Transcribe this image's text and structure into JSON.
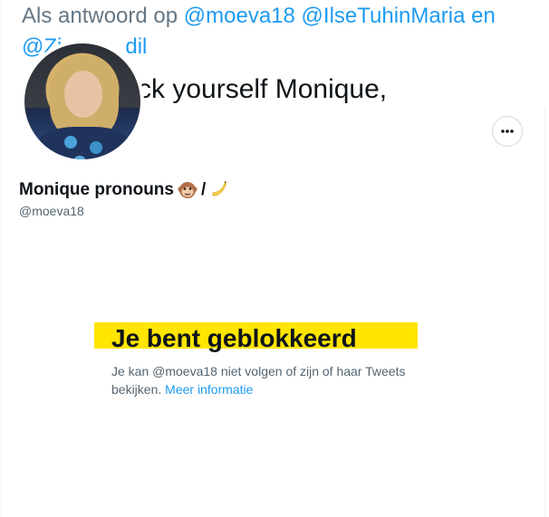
{
  "banner": {
    "reply_prefix": "Als antwoord op",
    "mention_1": "@moeva18",
    "mention_2": "@IlseTuhinMaria",
    "conjunction": "en",
    "line2": "@Zi",
    "line2_tail": "dil",
    "line3": "ck yourself Monique,"
  },
  "profile": {
    "name": "Monique pronouns",
    "separator": "/",
    "emoji_1": "monkey-face",
    "emoji_2": "banana",
    "handle": "@moeva18"
  },
  "actions": {
    "more_icon": "more-horizontal-icon"
  },
  "blocked": {
    "title": "Je bent geblokkeerd",
    "description": "Je kan @moeva18 niet volgen of zijn of haar Tweets bekijken.",
    "link": "Meer informatie"
  },
  "colors": {
    "accent": "#1d9bf0",
    "highlight": "#ffe500",
    "text_primary": "#0f1419",
    "text_secondary": "#536471"
  }
}
